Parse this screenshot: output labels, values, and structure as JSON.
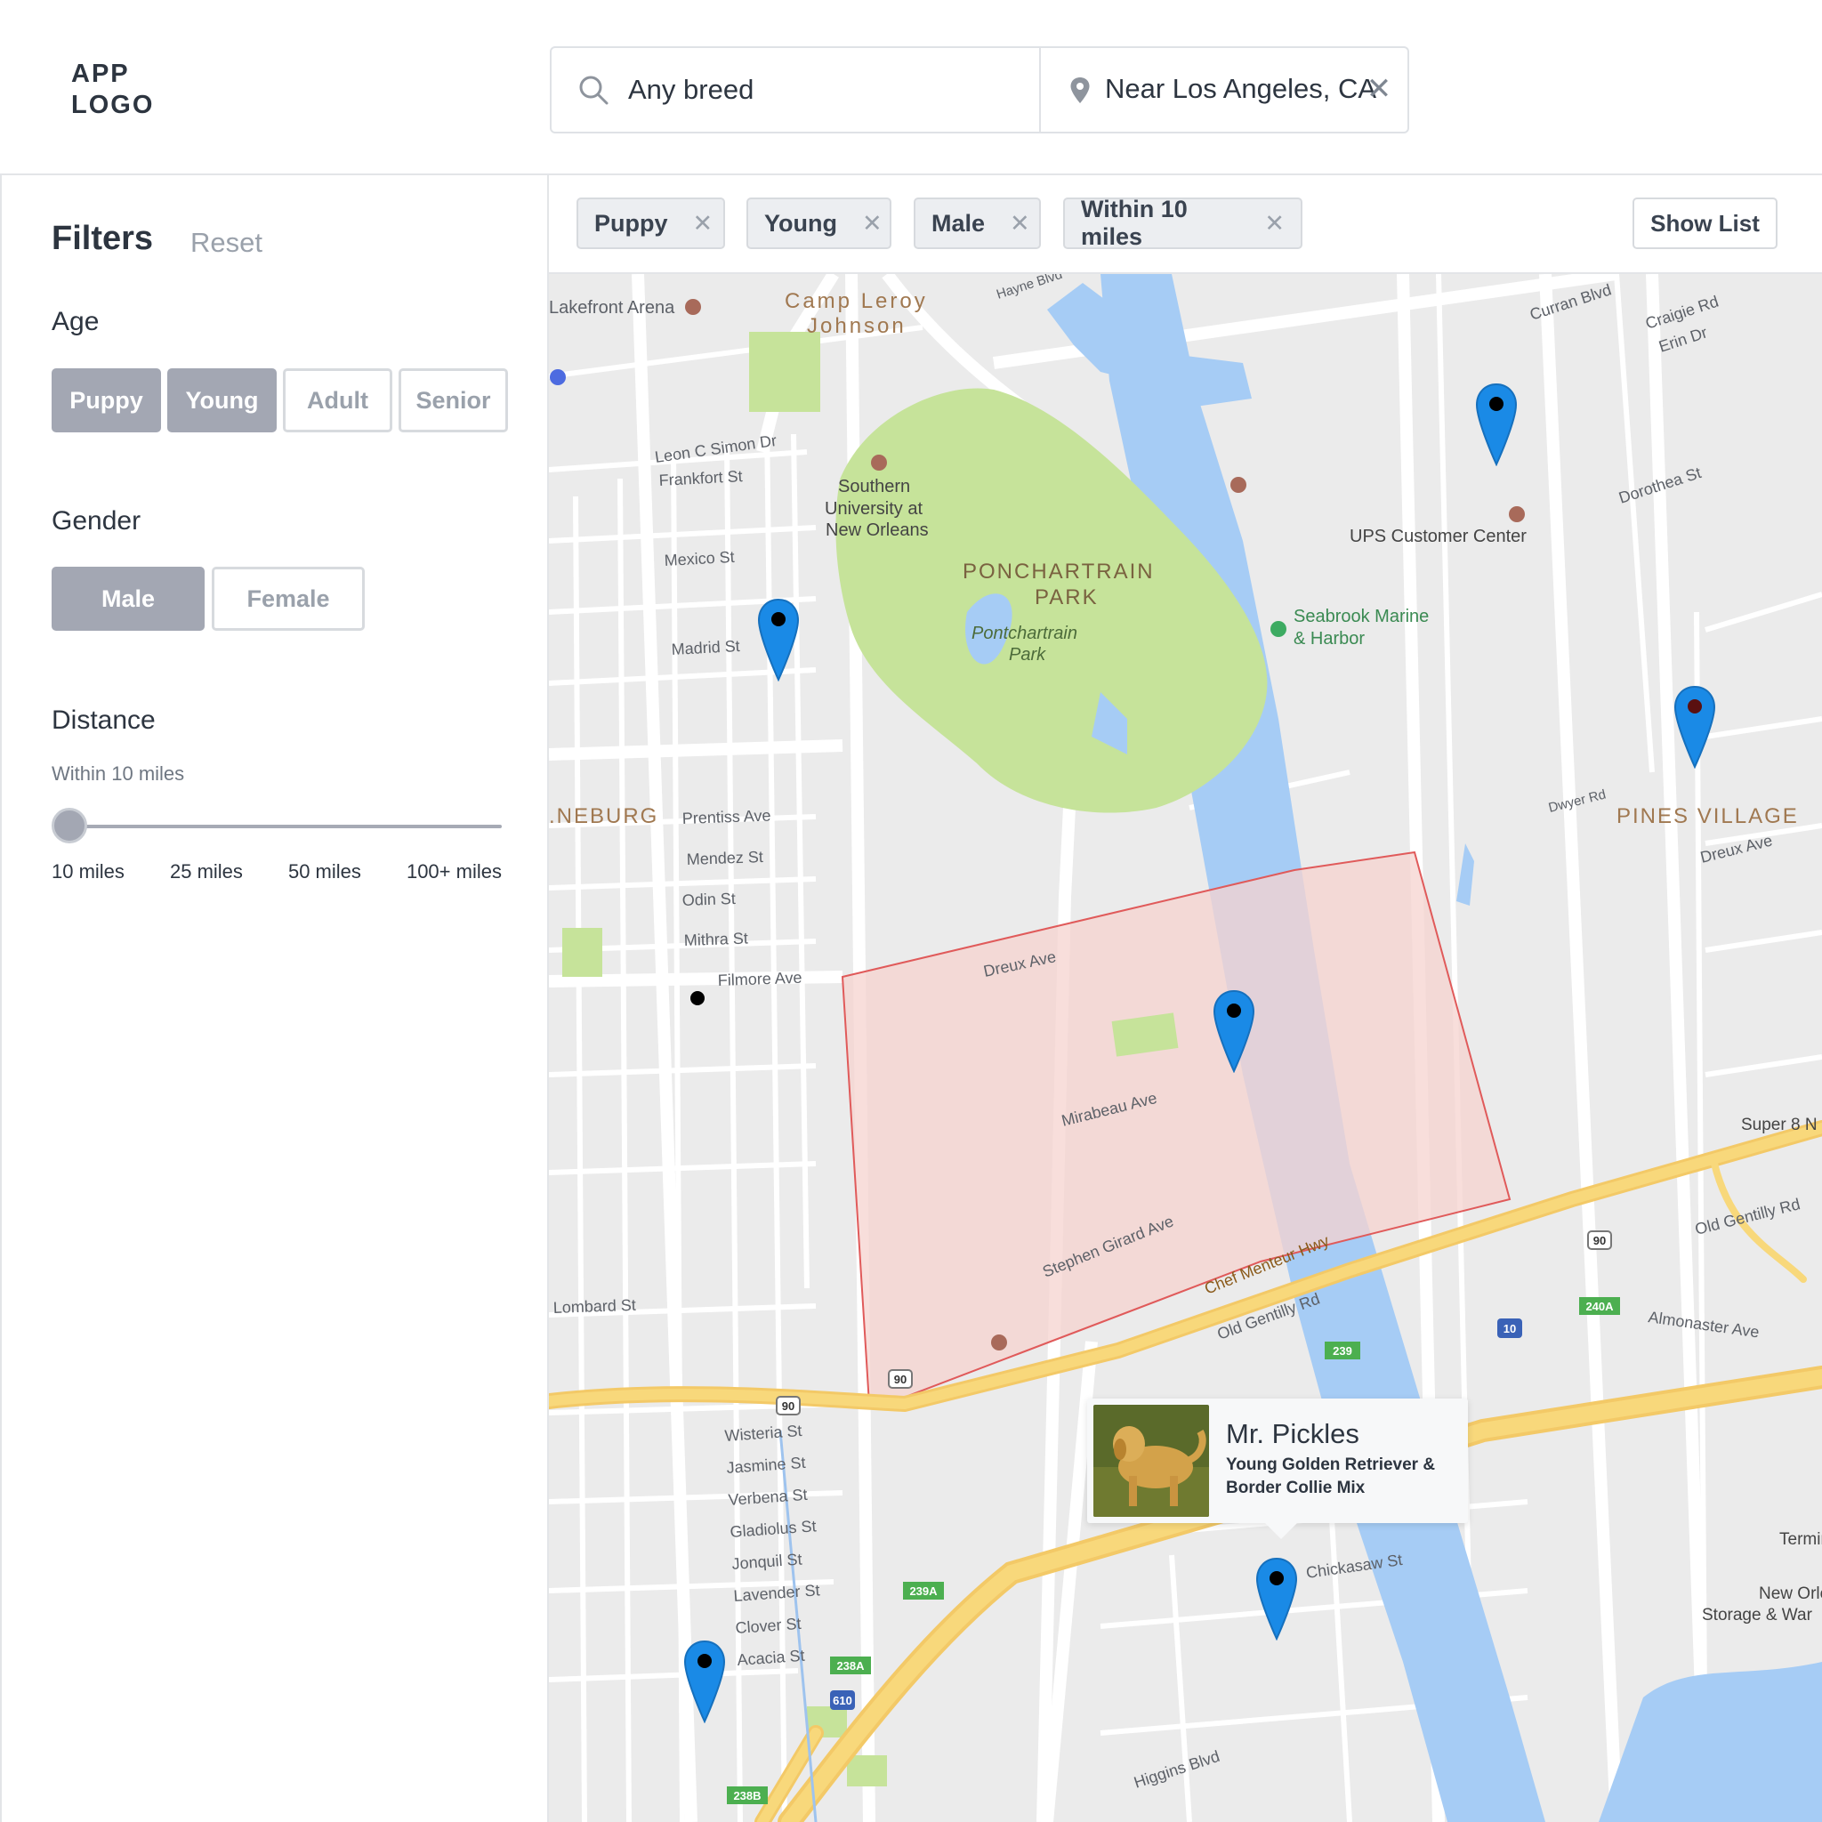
{
  "app": {
    "logo": "APP LOGO",
    "logo_line1": "APP",
    "logo_line2": "LOGO"
  },
  "search": {
    "breed_placeholder": "Any breed",
    "location_value": "Near Los Angeles, CA",
    "clear_glyph": "✕"
  },
  "sidebar": {
    "title": "Filters",
    "reset_label": "Reset",
    "age": {
      "label": "Age",
      "options": [
        {
          "label": "Puppy",
          "selected": true
        },
        {
          "label": "Young",
          "selected": true
        },
        {
          "label": "Adult",
          "selected": false
        },
        {
          "label": "Senior",
          "selected": false
        }
      ]
    },
    "gender": {
      "label": "Gender",
      "options": [
        {
          "label": "Male",
          "selected": true
        },
        {
          "label": "Female",
          "selected": false
        }
      ]
    },
    "distance": {
      "label": "Distance",
      "current": "Within 10 miles",
      "slider_value": 0,
      "stops": [
        "10 miles",
        "25 miles",
        "50 miles",
        "100+ miles"
      ]
    }
  },
  "chips": [
    {
      "label": "Puppy",
      "remove": "✕"
    },
    {
      "label": "Young",
      "remove": "✕"
    },
    {
      "label": "Male",
      "remove": "✕"
    },
    {
      "label": "Within 10 miles",
      "remove": "✕"
    }
  ],
  "show_list_label": "Show List",
  "map": {
    "labels": {
      "lakefront": "Lakefront Arena",
      "camp1": "Camp Leroy",
      "camp2": "Johnson",
      "park1": "PONCHARTRAIN",
      "park2": "PARK",
      "park_sub1": "Pontchartrain",
      "park_sub2": "Park",
      "univ1": "Southern",
      "univ2": "University at",
      "univ3": "New Orleans",
      "ups": "UPS Customer Center",
      "marine1": "Seabrook Marine",
      "marine2": "& Harbor",
      "pines": "PINES VILLAGE",
      "neburg": ".NEBURG",
      "leon": "Leon C Simon Dr",
      "frankfort": "Frankfort St",
      "mexico": "Mexico St",
      "madrid": "Madrid St",
      "prentiss": "Prentiss Ave",
      "mendez": "Mendez St",
      "odin": "Odin St",
      "mithra": "Mithra St",
      "filmore": "Filmore Ave",
      "lombard": "Lombard St",
      "wisteria": "Wisteria St",
      "jasmine": "Jasmine St",
      "verbena": "Verbena St",
      "gladiolus": "Gladiolus St",
      "jonquil": "Jonquil St",
      "lavender": "Lavender St",
      "clover": "Clover St",
      "acacia": "Acacia St",
      "dreux": "Dreux Ave",
      "mirabeau": "Mirabeau Ave",
      "stephen": "Stephen Girard Ave",
      "chef": "Chef Menteur Hwy",
      "oldgentilly": "Old Gentilly Rd",
      "almonaster": "Almonaster Ave",
      "curran": "Curran Blvd",
      "craigie": "Craigie Rd",
      "erin": "Erin Dr",
      "dorothea": "Dorothea St",
      "hayne": "Hayne Blvd",
      "higgins": "Higgins Blvd",
      "super8": "Super 8 N",
      "terminal": "Termina",
      "storage1": "New Orlea",
      "storage2": "Storage & War",
      "dreux2": "Dreux Ave",
      "dwyer": "Dwyer Rd",
      "chickasaw": "Chickasaw St",
      "hwy90a": "90",
      "hwy90b": "90",
      "hwy90c": "90",
      "i10": "10",
      "i610": "610",
      "exit239": "239",
      "exit240a": "240A",
      "exit239a": "239A",
      "exit238a": "238A",
      "exit238b": "238B"
    }
  },
  "pet_card": {
    "name": "Mr. Pickles",
    "description": "Young Golden Retriever & Border Collie Mix"
  },
  "colors": {
    "accent_marker": "#1a8ae6",
    "selected_button": "#a3a7b3",
    "search_area_fill": "#f5d3cf",
    "search_area_stroke": "#e05a5a",
    "water": "#a6ccf5",
    "park": "#c6e39a",
    "highway": "#f8d87b"
  }
}
